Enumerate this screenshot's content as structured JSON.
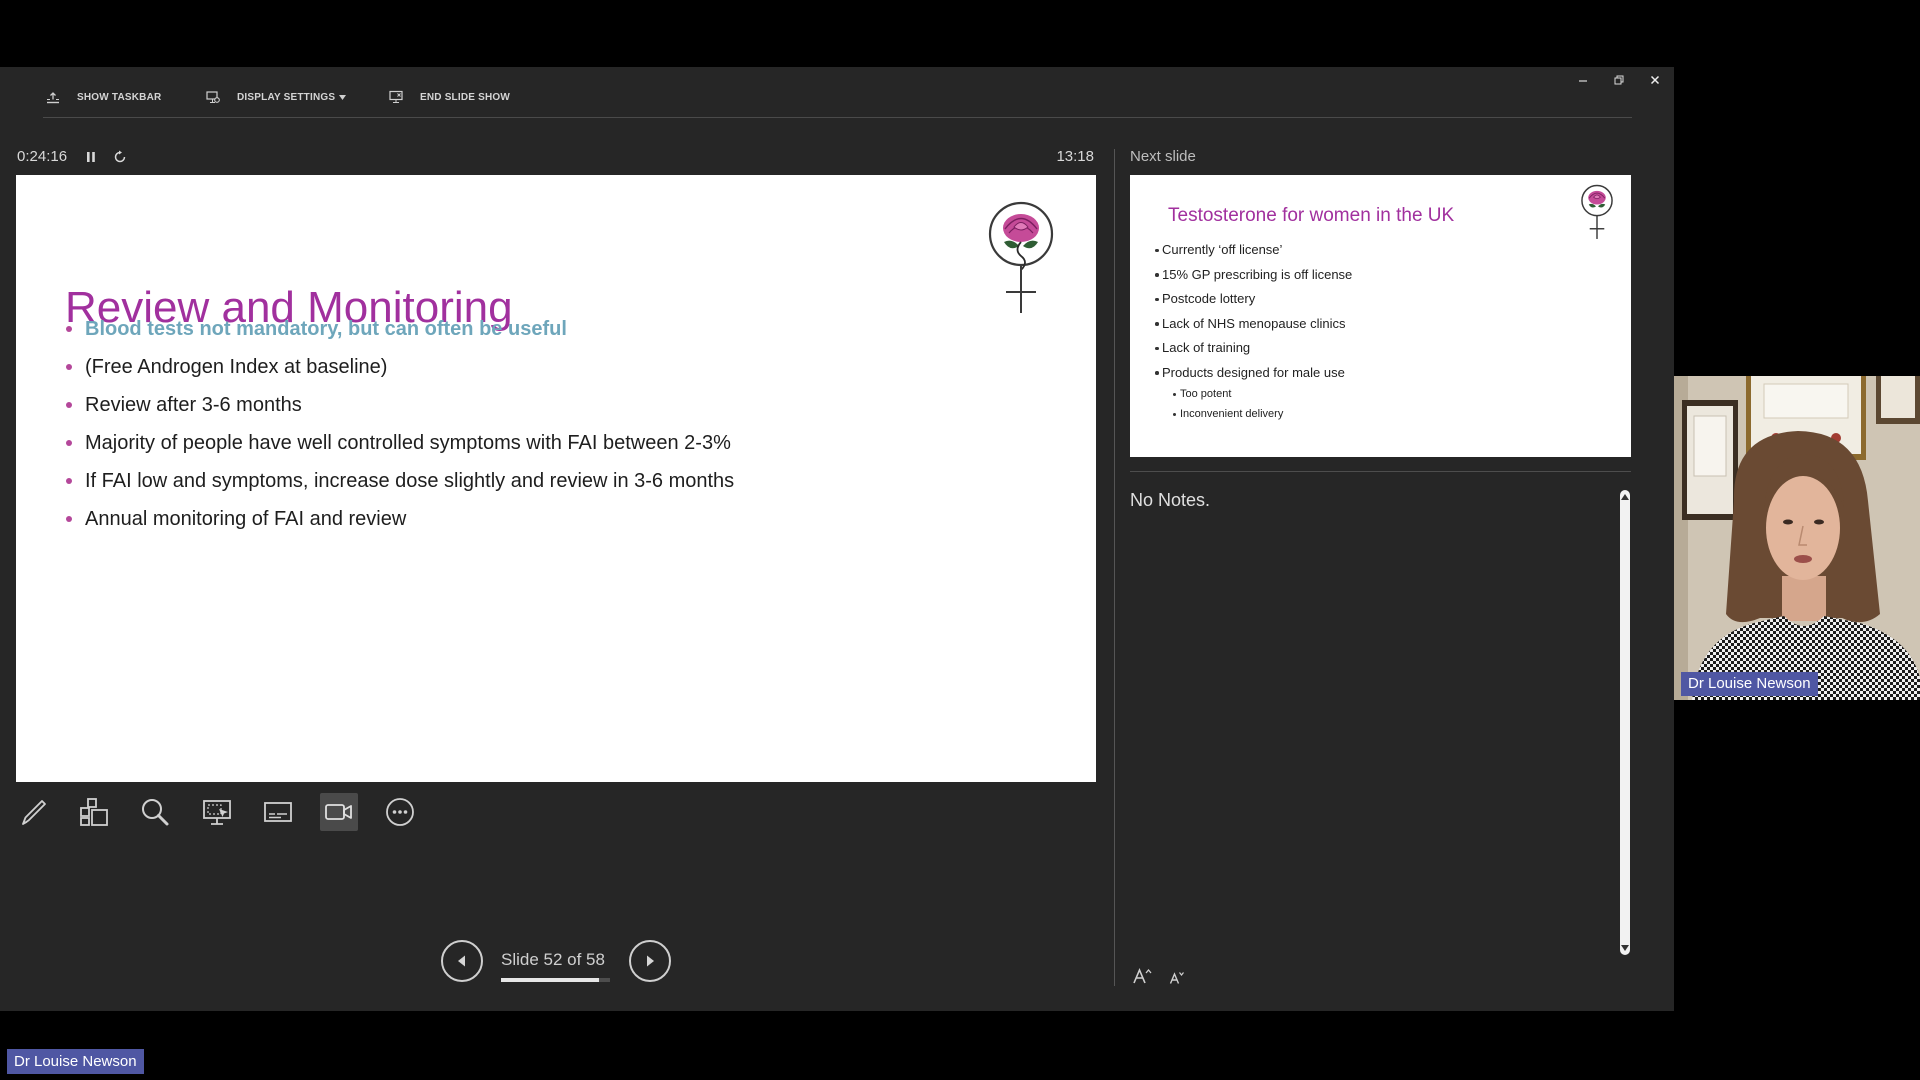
{
  "toolbar": {
    "show_taskbar_label": "SHOW TASKBAR",
    "display_settings_label": "DISPLAY SETTINGS",
    "end_slide_show_label": "END SLIDE SHOW"
  },
  "timer": {
    "elapsed": "0:24:16",
    "clock": "13:18"
  },
  "current_slide": {
    "title": "Review and Monitoring",
    "bullets": [
      {
        "text": "Blood tests not mandatory, but can often be useful",
        "emphasis": true
      },
      {
        "text": "(Free Androgen Index at baseline)"
      },
      {
        "text": "Review after 3-6 months"
      },
      {
        "text": "Majority of people have well controlled symptoms with FAI between 2-3%"
      },
      {
        "text": "If FAI low and symptoms, increase dose slightly and review in 3-6 months"
      },
      {
        "text": "Annual monitoring of FAI and review"
      }
    ]
  },
  "next_slide": {
    "label": "Next slide",
    "title": "Testosterone for women in the UK",
    "bullets": [
      {
        "text": "Currently ‘off license’"
      },
      {
        "text": "15% GP prescribing is off license"
      },
      {
        "text": "Postcode lottery"
      },
      {
        "text": "Lack of NHS menopause clinics"
      },
      {
        "text": "Lack of training"
      },
      {
        "text": "Products designed for male use",
        "sub_bullets": [
          "Too potent",
          "Inconvenient delivery"
        ]
      }
    ]
  },
  "notes": {
    "text": "No Notes."
  },
  "navigation": {
    "counter": "Slide 52 of 58",
    "progress": 0.9
  },
  "video": {
    "participant_name": "Dr Louise Newson"
  },
  "bottom_badge": {
    "name": "Dr Louise Newson"
  },
  "icons": {
    "toolbar": [
      "taskbar-icon",
      "display-settings-icon",
      "chevron-down-icon",
      "end-slideshow-icon"
    ],
    "window": [
      "minimize-icon",
      "restore-icon",
      "close-icon"
    ],
    "timer": [
      "pause-icon",
      "restart-icon"
    ],
    "tools": [
      "pen-icon",
      "all-slides-icon",
      "zoom-icon",
      "laser-pointer-icon",
      "subtitles-icon",
      "camera-icon",
      "more-icon"
    ],
    "notes": [
      "increase-font-icon",
      "decrease-font-icon"
    ]
  },
  "colors": {
    "window_background": "#262626",
    "slide_title": "#a1309e",
    "emphasis_text": "#6ea6bb",
    "bullet_dot": "#b4479a",
    "name_badge": "#4f57a3"
  }
}
